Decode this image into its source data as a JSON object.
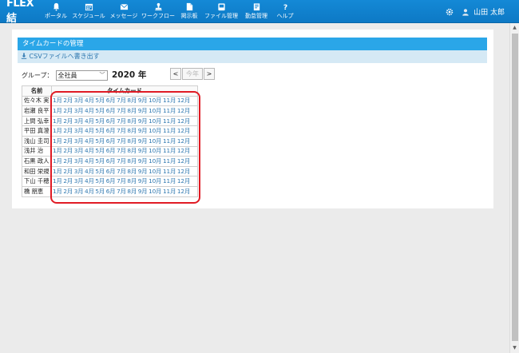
{
  "app": {
    "logo": "FLEX結"
  },
  "nav": [
    {
      "name": "nav-portal",
      "icon": "bell-icon",
      "label": "ポータル"
    },
    {
      "name": "nav-schedule",
      "icon": "calendar-icon",
      "label": "スケジュール"
    },
    {
      "name": "nav-message",
      "icon": "envelope-icon",
      "label": "メッセージ"
    },
    {
      "name": "nav-workflow",
      "icon": "stamp-icon",
      "label": "ワークフロー"
    },
    {
      "name": "nav-board",
      "icon": "document-icon",
      "label": "掲示板"
    },
    {
      "name": "nav-files",
      "icon": "folder-icon",
      "label": "ファイル管理"
    },
    {
      "name": "nav-attendance",
      "icon": "clipboard-icon",
      "label": "勤怠管理"
    },
    {
      "name": "nav-help",
      "icon": "question-icon",
      "label": "ヘルプ"
    }
  ],
  "user": {
    "name": "山田 太郎",
    "settings_icon": "gear-icon",
    "avatar_icon": "user-icon"
  },
  "panel": {
    "title": "タイムカードの管理",
    "csv_label": "CSVファイルへ書き出す"
  },
  "filters": {
    "group_label": "グループ：",
    "group_value": "全社員"
  },
  "year": {
    "label": "2020 年",
    "prev": "<",
    "this_year": "今年",
    "next": ">"
  },
  "table": {
    "headers": {
      "name": "名前",
      "timecard": "タイムカード"
    },
    "months": [
      "1月",
      "2月",
      "3月",
      "4月",
      "5月",
      "6月",
      "7月",
      "8月",
      "9月",
      "10月",
      "11月",
      "12月"
    ],
    "rows": [
      "佐々木 実",
      "岩瀬 良平",
      "上間 弘幸",
      "平田 真澄",
      "浅山 圭司",
      "浅井 治",
      "石黒 政人",
      "和田 栄規",
      "下山 千穂",
      "橋 朋恵"
    ]
  }
}
